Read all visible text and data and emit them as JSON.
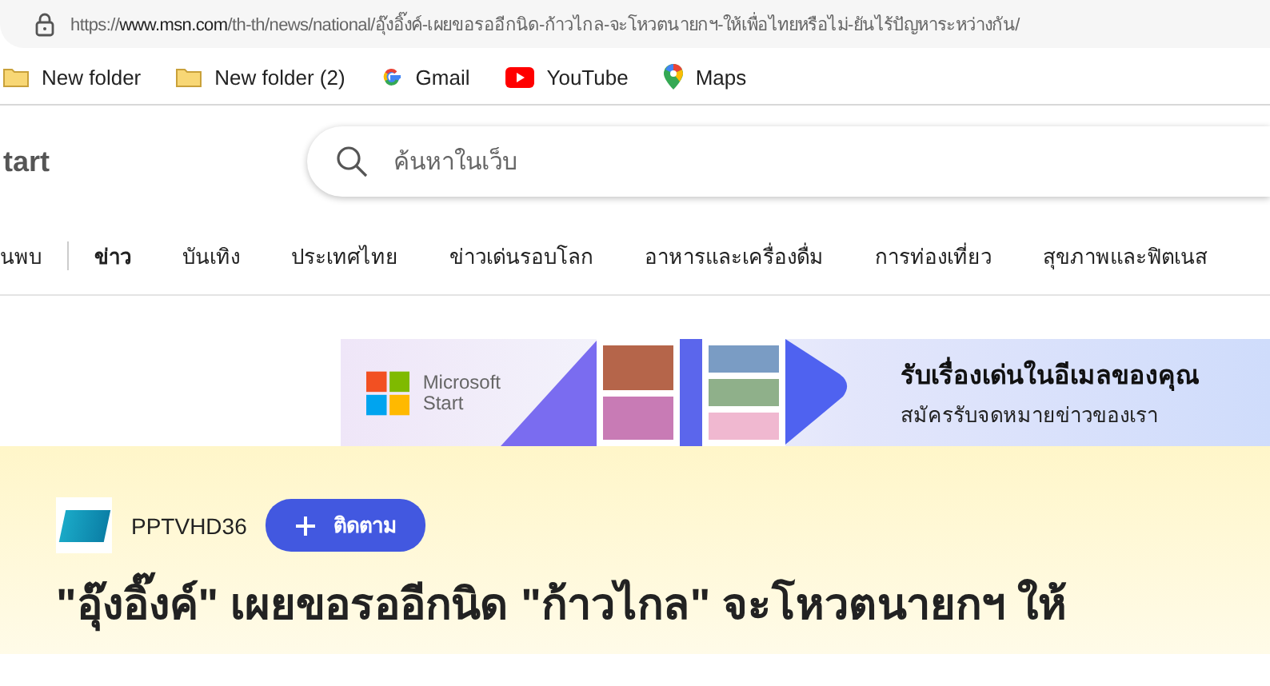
{
  "address_bar": {
    "url_prefix": "https://",
    "url_host": "www.msn.com",
    "url_path": "/th-th/news/national/อุ๊งอิ๊งค์-เผยขอรออีกนิด-ก้าวไกล-จะโหวตนายกฯ-ให้เพื่อไทยหรือไม่-ยันไร้ปัญหาระหว่างกัน/"
  },
  "bookmarks": [
    {
      "label": "New folder",
      "kind": "folder"
    },
    {
      "label": "New folder (2)",
      "kind": "folder"
    },
    {
      "label": "Gmail",
      "kind": "google"
    },
    {
      "label": "YouTube",
      "kind": "youtube"
    },
    {
      "label": "Maps",
      "kind": "maps"
    }
  ],
  "header": {
    "brand": "tart",
    "search": {
      "placeholder": "ค้นหาในเว็บ"
    }
  },
  "nav": [
    {
      "label": "นพบ",
      "selected": false
    },
    {
      "label": "ข่าว",
      "selected": true
    },
    {
      "label": "บันเทิง",
      "selected": false
    },
    {
      "label": "ประเทศไทย",
      "selected": false
    },
    {
      "label": "ข่าวเด่นรอบโลก",
      "selected": false
    },
    {
      "label": "อาหารและเครื่องดื่ม",
      "selected": false
    },
    {
      "label": "การท่องเที่ยว",
      "selected": false
    },
    {
      "label": "สุขภาพและฟิตเนส",
      "selected": false
    }
  ],
  "banner": {
    "brand_line1": "Microsoft",
    "brand_line2": "Start",
    "headline": "รับเรื่องเด่นในอีเมลของคุณ",
    "subline": "สมัครรับจดหมายข่าวของเรา"
  },
  "article": {
    "publisher": "PPTVHD36",
    "follow_button": "ติดตาม",
    "title": "\"อุ๊งอิ๊งค์\" เผยขอรออีกนิด \"ก้าวไกล\" จะโหวตนายกฯ ให้"
  }
}
